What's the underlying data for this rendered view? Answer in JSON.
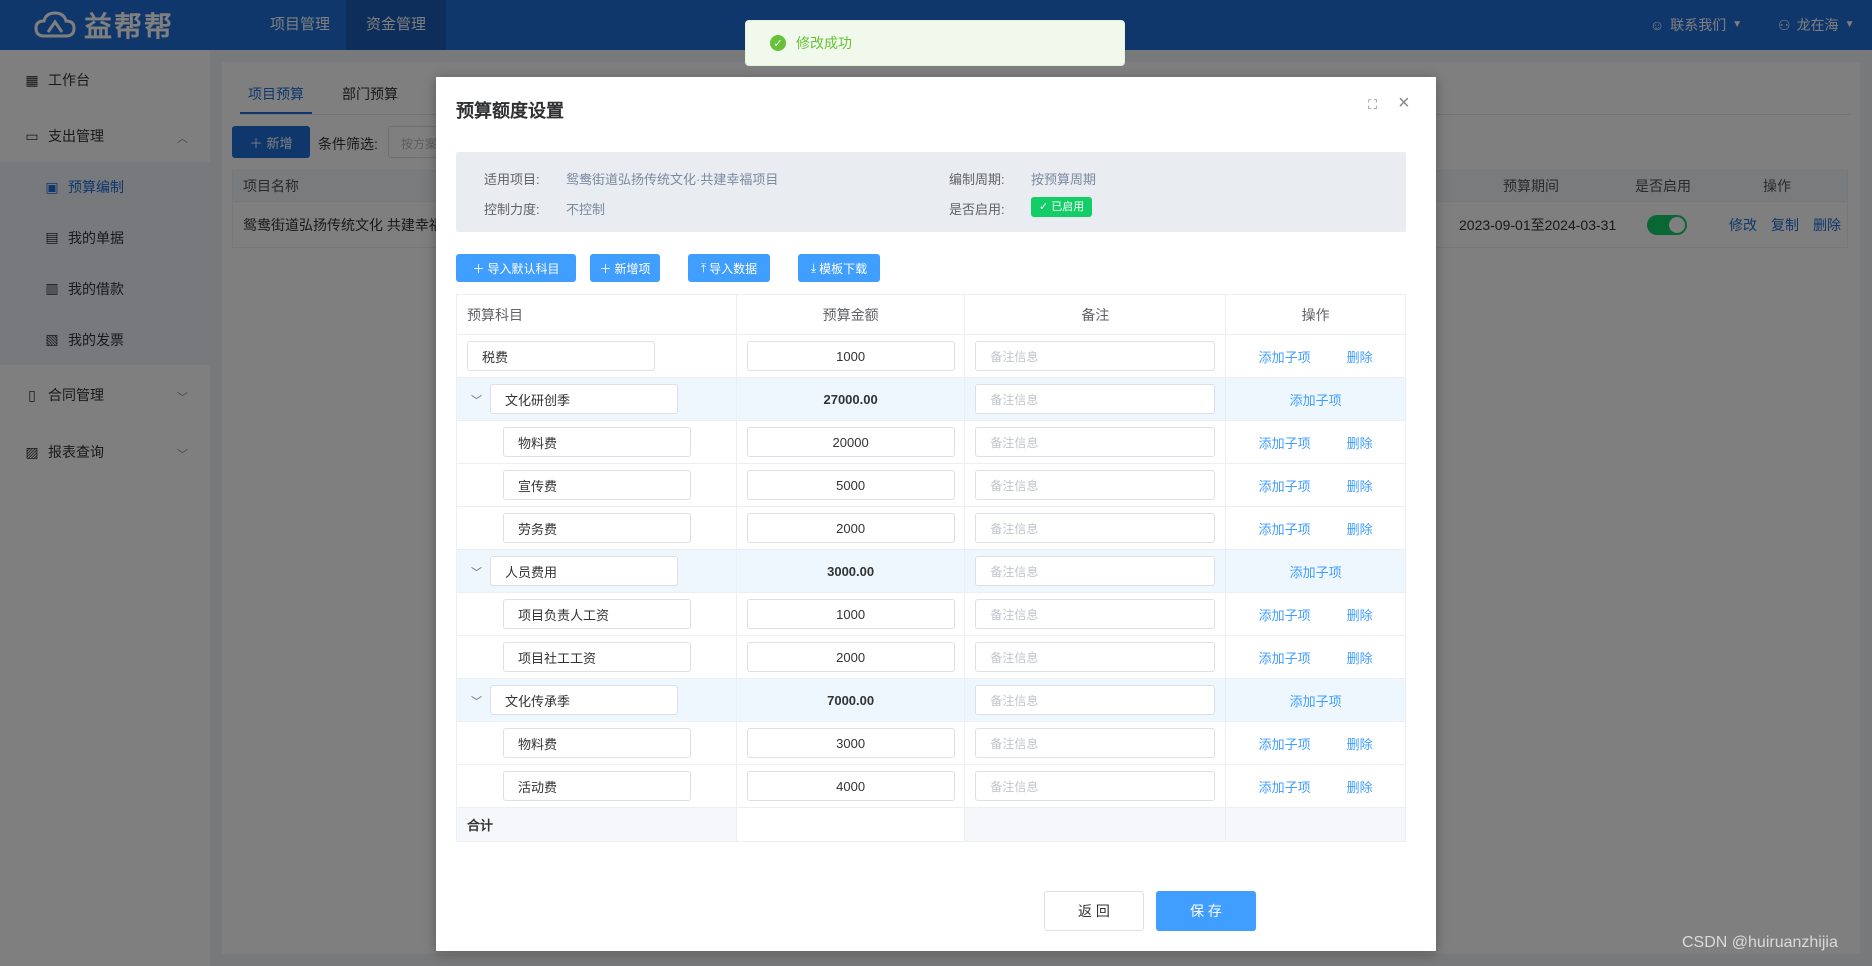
{
  "app": {
    "logo_text": "益帮帮",
    "brand_color": "#1f6fd6"
  },
  "topnav": [
    {
      "label": "项目管理"
    },
    {
      "label": "资金管理"
    }
  ],
  "top_right": {
    "contact": "联系我们",
    "user": "龙在海"
  },
  "sidebar": {
    "items": [
      {
        "label": "工作台"
      },
      {
        "label": "支出管理"
      },
      {
        "label": "预算编制"
      },
      {
        "label": "我的单据"
      },
      {
        "label": "我的借款"
      },
      {
        "label": "我的发票"
      },
      {
        "label": "合同管理"
      },
      {
        "label": "报表查询"
      }
    ]
  },
  "page": {
    "tabs": [
      {
        "label": "项目预算"
      },
      {
        "label": "部门预算"
      }
    ],
    "new_button": "新增",
    "filter_label": "条件筛选:",
    "filter_placeholder": "按方案",
    "table": {
      "headers": {
        "name": "项目名称",
        "period": "预算期间",
        "enabled": "是否启用",
        "ops": "操作"
      },
      "row": {
        "name": "鸳鸯街道弘扬传统文化 共建幸福",
        "period": "2023-09-01至2024-03-31",
        "edit": "修改",
        "copy": "复制",
        "delete": "删除"
      }
    }
  },
  "toast": {
    "text": "修改成功"
  },
  "dialog": {
    "title": "预算额度设置",
    "info": {
      "project_label": "适用项目:",
      "project_value": "鸳鸯街道弘扬传统文化·共建幸福项目",
      "cycle_label": "编制周期:",
      "cycle_value": "按预算周期",
      "control_label": "控制力度:",
      "control_value": "不控制",
      "enabled_label": "是否启用:",
      "enabled_value": "已启用"
    },
    "toolbar": {
      "import_default": "导入默认科目",
      "add_item": "新增项",
      "import_data": "导入数据",
      "template_download": "模板下载"
    },
    "grid": {
      "headers": {
        "subject": "预算科目",
        "amount": "预算金额",
        "note": "备注",
        "ops": "操作"
      },
      "note_placeholder": "备注信息",
      "add_child": "添加子项",
      "delete": "删除",
      "rows": [
        {
          "name": "税费",
          "amount": "1000"
        },
        {
          "name": "文化研创季",
          "amount": "27000.00"
        },
        {
          "name": "物料费",
          "amount": "20000"
        },
        {
          "name": "宣传费",
          "amount": "5000"
        },
        {
          "name": "劳务费",
          "amount": "2000"
        },
        {
          "name": "人员费用",
          "amount": "3000.00"
        },
        {
          "name": "项目负责人工资",
          "amount": "1000"
        },
        {
          "name": "项目社工工资",
          "amount": "2000"
        },
        {
          "name": "文化传承季",
          "amount": "7000.00"
        },
        {
          "name": "物料费",
          "amount": "3000"
        },
        {
          "name": "活动费",
          "amount": "4000"
        }
      ],
      "total_label": "合计"
    },
    "back_button": "返 回",
    "save_button": "保 存"
  },
  "watermark": "CSDN @huiruanzhijia"
}
